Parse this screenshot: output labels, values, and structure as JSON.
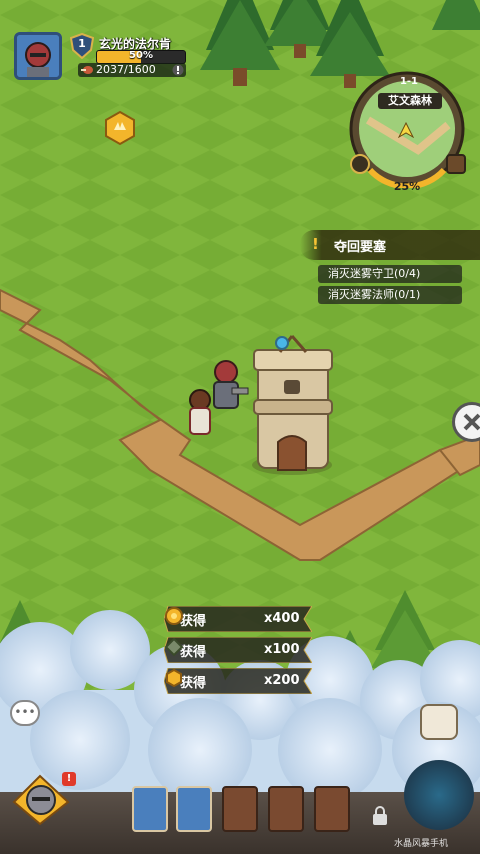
{
  "player": {
    "level": "1",
    "name": "玄光的法尔肯",
    "xp_percent_text": "50%",
    "xp_fraction": 0.5,
    "stamina_text": "2037/1600"
  },
  "minimap": {
    "stage": "1-1",
    "area_name": "艾文森林",
    "progress_text": "25%"
  },
  "quest": {
    "title": "夺回要塞",
    "items": [
      "消灭迷雾守卫(0/4)",
      "消灭迷雾法师(0/1)"
    ]
  },
  "rewards": [
    {
      "label": "获得",
      "icon": "gold-coin-icon",
      "amount": "x400"
    },
    {
      "label": "获得",
      "icon": "gem-icon",
      "amount": "x100"
    },
    {
      "label": "获得",
      "icon": "crown-medal-icon",
      "amount": "x200"
    }
  ],
  "watermark": "水晶风暴手机",
  "colors": {
    "grass": "#7fb53a",
    "path": "#c9975a",
    "fog": "#cfe0f0",
    "accent_gold": "#f3b52b"
  }
}
